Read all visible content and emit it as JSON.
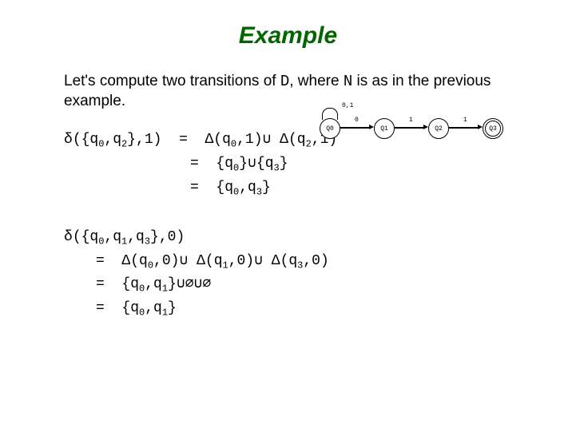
{
  "title": "Example",
  "intro": {
    "prefix": "Let's compute two transitions of ",
    "d": "D",
    "mid": ", where ",
    "n": "N",
    "suffix": " is as in the previous example."
  },
  "automaton": {
    "states": [
      "Q0",
      "Q1",
      "Q2",
      "Q3"
    ],
    "loop_label": "0,1",
    "edge01": "0",
    "edge12": "1",
    "edge23": "1"
  },
  "eq1": {
    "lhs_delta": "δ",
    "lhs_open": "({q",
    "lhs_s0": "0",
    "lhs_mid": ",q",
    "lhs_s2": "2",
    "lhs_close": "},1)",
    "eq": "=",
    "r1_DeltaA": "Δ(q",
    "r1_a0": "0",
    "r1_aEnd": ",1)",
    "cup": "∪",
    "r1_DeltaB": "Δ(q",
    "r1_b2": "2",
    "r1_bEnd": ",1)",
    "r2_open": "{q",
    "r2_s0": "0",
    "r2_close": "}",
    "r2_open2": "{q",
    "r2_s3": "3",
    "r2_close2": "}",
    "r3_open": "{q",
    "r3_s0": "0",
    "r3_mid": ",q",
    "r3_s3": "3",
    "r3_close": "}"
  },
  "eq2": {
    "lhs_delta": "δ",
    "lhs_open": "({q",
    "lhs_s0": "0",
    "lhs_m1": ",q",
    "lhs_s1": "1",
    "lhs_m2": ",q",
    "lhs_s3": "3",
    "lhs_close": "},0)",
    "eq": "=",
    "r1_DA": "Δ(q",
    "r1_a0": "0",
    "r1_aEnd": ",0)",
    "cup": "∪",
    "r1_DB": "Δ(q",
    "r1_b1": "1",
    "r1_bEnd": ",0)",
    "r1_DC": "Δ(q",
    "r1_c3": "3",
    "r1_cEnd": ",0)",
    "r2_open": "{q",
    "r2_s0": "0",
    "r2_mid": ",q",
    "r2_s1": "1",
    "r2_close": "}",
    "empty": "∅",
    "r3_open": "{q",
    "r3_s0": "0",
    "r3_mid": ",q",
    "r3_s1": "1",
    "r3_close": "}"
  }
}
